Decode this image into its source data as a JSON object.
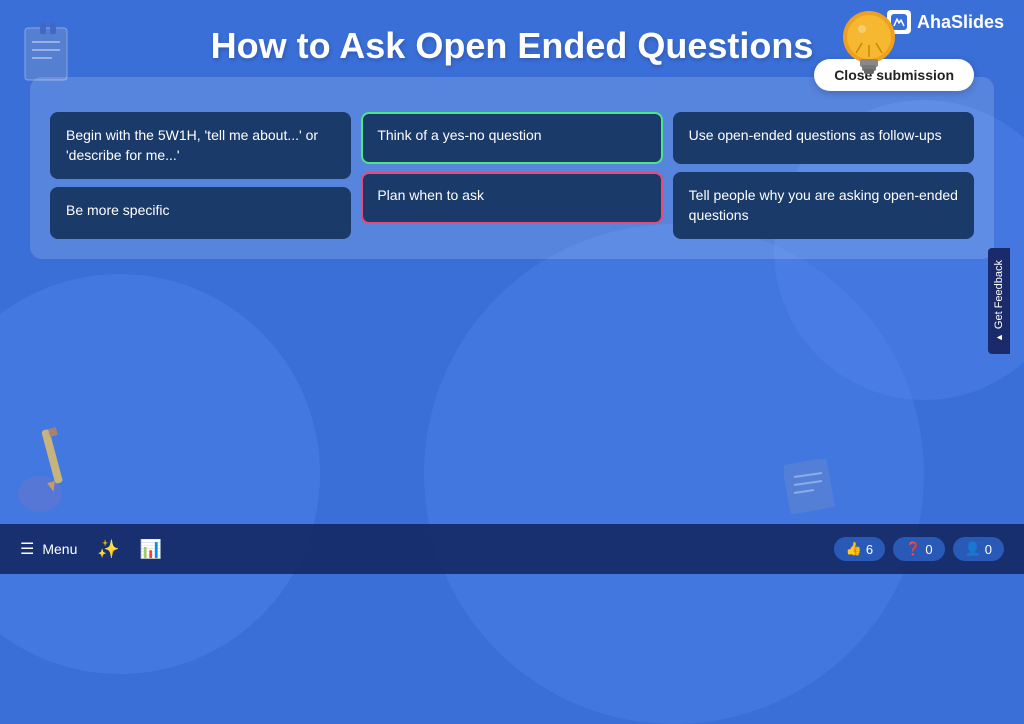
{
  "app": {
    "logo": "AhaSlides",
    "title": "How to Ask Open Ended Questions"
  },
  "close_button": {
    "label": "Close submission"
  },
  "cards": {
    "col1": [
      {
        "id": "card-1",
        "text": "Begin with the 5W1H, 'tell me about...' or 'describe for me...'",
        "selected": false
      },
      {
        "id": "card-2",
        "text": "Be more specific",
        "selected": false
      }
    ],
    "col2": [
      {
        "id": "card-3",
        "text": "Think of a yes-no question",
        "selected": "green"
      },
      {
        "id": "card-4",
        "text": "Plan when to ask",
        "selected": "pink"
      }
    ],
    "col3": [
      {
        "id": "card-5",
        "text": "Use open-ended questions as follow-ups",
        "selected": false
      },
      {
        "id": "card-6",
        "text": "Tell people why you are asking open-ended questions",
        "selected": false
      }
    ]
  },
  "bottom_bar": {
    "menu_label": "Menu",
    "stats": [
      {
        "icon": "👍",
        "value": "6"
      },
      {
        "icon": "❓",
        "value": "0"
      },
      {
        "icon": "👤",
        "value": "0"
      }
    ]
  },
  "feedback_tab": {
    "label": "Get Feedback"
  }
}
